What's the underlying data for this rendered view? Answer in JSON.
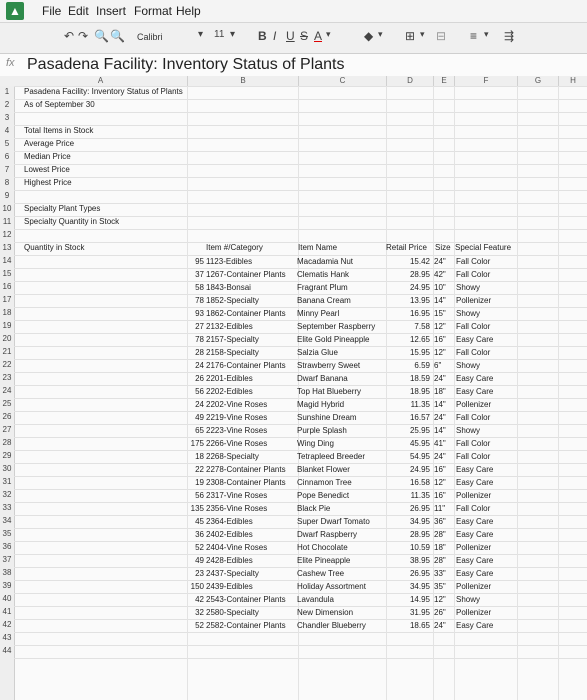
{
  "menu": {
    "file": "File",
    "edit": "Edit",
    "insert": "Insert",
    "format": "Format",
    "help": "Help"
  },
  "toolbar": {
    "font_name": "Calibri",
    "font_size": "11",
    "bold": "B",
    "italic": "I",
    "underline": "U",
    "strike": "S"
  },
  "formula_bar": {
    "fx": "fx",
    "content": "Pasadena Facility: Inventory Status of Plants"
  },
  "columns": [
    "A",
    "B",
    "C",
    "D",
    "E",
    "F",
    "G",
    "H"
  ],
  "rows": [
    "1",
    "2",
    "3",
    "4",
    "5",
    "6",
    "7",
    "8",
    "9",
    "10",
    "11",
    "12",
    "13",
    "14",
    "15",
    "16",
    "17",
    "18",
    "19",
    "20",
    "21",
    "22",
    "23",
    "24",
    "25",
    "26",
    "27",
    "28",
    "29",
    "30",
    "31",
    "32",
    "33",
    "34",
    "35",
    "36",
    "37",
    "38",
    "39",
    "40",
    "41",
    "42",
    "43",
    "44"
  ],
  "labels": {
    "title": "Pasadena Facility: Inventory Status of Plants",
    "as_of": "As of September 30",
    "total": "Total Items in Stock",
    "avg": "Average Price",
    "median": "Median Price",
    "lowest": "Lowest Price",
    "highest": "Highest Price",
    "specialty_types": "Specialty Plant Types",
    "specialty_qty": "Specialty Quantity in Stock"
  },
  "table": {
    "headers": {
      "qty": "Quantity in Stock",
      "item": "Item #/Category",
      "name": "Item Name",
      "price": "Retail Price",
      "size": "Size",
      "feature": "Special Feature"
    },
    "rows": [
      {
        "qty": "95",
        "item": "1123-Edibles",
        "name": "Macadamia Nut",
        "price": "15.42",
        "size": "24\"",
        "feature": "Fall Color"
      },
      {
        "qty": "37",
        "item": "1267-Container Plants",
        "name": "Clematis Hank",
        "price": "28.95",
        "size": "42\"",
        "feature": "Fall Color"
      },
      {
        "qty": "58",
        "item": "1843-Bonsai",
        "name": "Fragrant Plum",
        "price": "24.95",
        "size": "10\"",
        "feature": "Showy"
      },
      {
        "qty": "78",
        "item": "1852-Specialty",
        "name": "Banana Cream",
        "price": "13.95",
        "size": "14\"",
        "feature": "Pollenizer"
      },
      {
        "qty": "93",
        "item": "1862-Container Plants",
        "name": "Minny Pearl",
        "price": "16.95",
        "size": "15\"",
        "feature": "Showy"
      },
      {
        "qty": "27",
        "item": "2132-Edibles",
        "name": "September Raspberry",
        "price": "7.58",
        "size": "12\"",
        "feature": "Fall Color"
      },
      {
        "qty": "78",
        "item": "2157-Specialty",
        "name": "Elite Gold Pineapple",
        "price": "12.65",
        "size": "16\"",
        "feature": "Easy Care"
      },
      {
        "qty": "28",
        "item": "2158-Specialty",
        "name": "Salzia Glue",
        "price": "15.95",
        "size": "12\"",
        "feature": "Fall Color"
      },
      {
        "qty": "24",
        "item": "2176-Container Plants",
        "name": "Strawberry Sweet",
        "price": "6.59",
        "size": "6\"",
        "feature": "Showy"
      },
      {
        "qty": "26",
        "item": "2201-Edibles",
        "name": "Dwarf Banana",
        "price": "18.59",
        "size": "24\"",
        "feature": "Easy Care"
      },
      {
        "qty": "56",
        "item": "2202-Edibles",
        "name": "Top Hat Blueberry",
        "price": "18.95",
        "size": "18\"",
        "feature": "Easy Care"
      },
      {
        "qty": "24",
        "item": "2202-Vine Roses",
        "name": "Magid Hybrid",
        "price": "11.35",
        "size": "14\"",
        "feature": "Pollenizer"
      },
      {
        "qty": "49",
        "item": "2219-Vine Roses",
        "name": "Sunshine Dream",
        "price": "16.57",
        "size": "24\"",
        "feature": "Fall Color"
      },
      {
        "qty": "65",
        "item": "2223-Vine Roses",
        "name": "Purple Splash",
        "price": "25.95",
        "size": "14\"",
        "feature": "Showy"
      },
      {
        "qty": "175",
        "item": "2266-Vine Roses",
        "name": "Wing Ding",
        "price": "45.95",
        "size": "41\"",
        "feature": "Fall Color"
      },
      {
        "qty": "18",
        "item": "2268-Specialty",
        "name": "Tetrapleed Breeder",
        "price": "54.95",
        "size": "24\"",
        "feature": "Fall Color"
      },
      {
        "qty": "22",
        "item": "2278-Container Plants",
        "name": "Blanket Flower",
        "price": "24.95",
        "size": "16\"",
        "feature": "Easy Care"
      },
      {
        "qty": "19",
        "item": "2308-Container Plants",
        "name": "Cinnamon Tree",
        "price": "16.58",
        "size": "12\"",
        "feature": "Easy Care"
      },
      {
        "qty": "56",
        "item": "2317-Vine Roses",
        "name": "Pope Benedict",
        "price": "11.35",
        "size": "16\"",
        "feature": "Pollenizer"
      },
      {
        "qty": "135",
        "item": "2356-Vine Roses",
        "name": "Black Pie",
        "price": "26.95",
        "size": "11\"",
        "feature": "Fall Color"
      },
      {
        "qty": "45",
        "item": "2364-Edibles",
        "name": "Super Dwarf Tomato",
        "price": "34.95",
        "size": "36\"",
        "feature": "Easy Care"
      },
      {
        "qty": "36",
        "item": "2402-Edibles",
        "name": "Dwarf Raspberry",
        "price": "28.95",
        "size": "28\"",
        "feature": "Easy Care"
      },
      {
        "qty": "52",
        "item": "2404-Vine Roses",
        "name": "Hot Chocolate",
        "price": "10.59",
        "size": "18\"",
        "feature": "Pollenizer"
      },
      {
        "qty": "49",
        "item": "2428-Edibles",
        "name": "Elite Pineapple",
        "price": "38.95",
        "size": "28\"",
        "feature": "Easy Care"
      },
      {
        "qty": "23",
        "item": "2437-Specialty",
        "name": "Cashew Tree",
        "price": "26.95",
        "size": "33\"",
        "feature": "Easy Care"
      },
      {
        "qty": "150",
        "item": "2439-Edibles",
        "name": "Holiday Assortment",
        "price": "34.95",
        "size": "35\"",
        "feature": "Pollenizer"
      },
      {
        "qty": "42",
        "item": "2543-Container Plants",
        "name": "Lavandula",
        "price": "14.95",
        "size": "12\"",
        "feature": "Showy"
      },
      {
        "qty": "32",
        "item": "2580-Specialty",
        "name": "New Dimension",
        "price": "31.95",
        "size": "26\"",
        "feature": "Pollenizer"
      },
      {
        "qty": "52",
        "item": "2582-Container Plants",
        "name": "Chandler Blueberry",
        "price": "18.65",
        "size": "24\"",
        "feature": "Easy Care"
      }
    ]
  }
}
